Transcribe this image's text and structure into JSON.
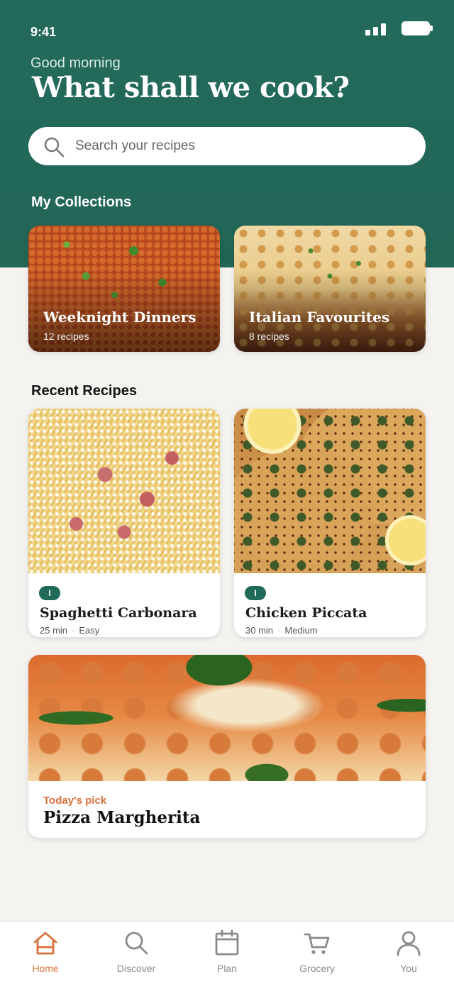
{
  "status": {
    "time": "9:41"
  },
  "header": {
    "greeting": "Good morning",
    "title": "What shall we cook?"
  },
  "search": {
    "placeholder": "Search your recipes",
    "icon": "search-icon"
  },
  "collections": {
    "title": "My Collections",
    "items": [
      {
        "name": "Weeknight Dinners",
        "count": "12 recipes"
      },
      {
        "name": "Italian Favourites",
        "count": "8 recipes"
      }
    ]
  },
  "recent": {
    "title": "Recent Recipes",
    "items": [
      {
        "tag": "I",
        "name": "Spaghetti Carbonara",
        "time": "25 min",
        "difficulty": "Easy"
      },
      {
        "tag": "I",
        "name": "Chicken Piccata",
        "time": "30 min",
        "difficulty": "Medium"
      }
    ]
  },
  "pick": {
    "label": "Today's pick",
    "name": "Pizza Margherita"
  },
  "tabs": [
    {
      "label": "Home",
      "icon": "home-icon",
      "active": true
    },
    {
      "label": "Discover",
      "icon": "search-icon",
      "active": false
    },
    {
      "label": "Plan",
      "icon": "calendar-icon",
      "active": false
    },
    {
      "label": "Grocery",
      "icon": "cart-icon",
      "active": false
    },
    {
      "label": "You",
      "icon": "user-icon",
      "active": false
    }
  ],
  "colors": {
    "primary": "#236b5c",
    "accent": "#d9703a",
    "background": "#f5f3f0"
  }
}
